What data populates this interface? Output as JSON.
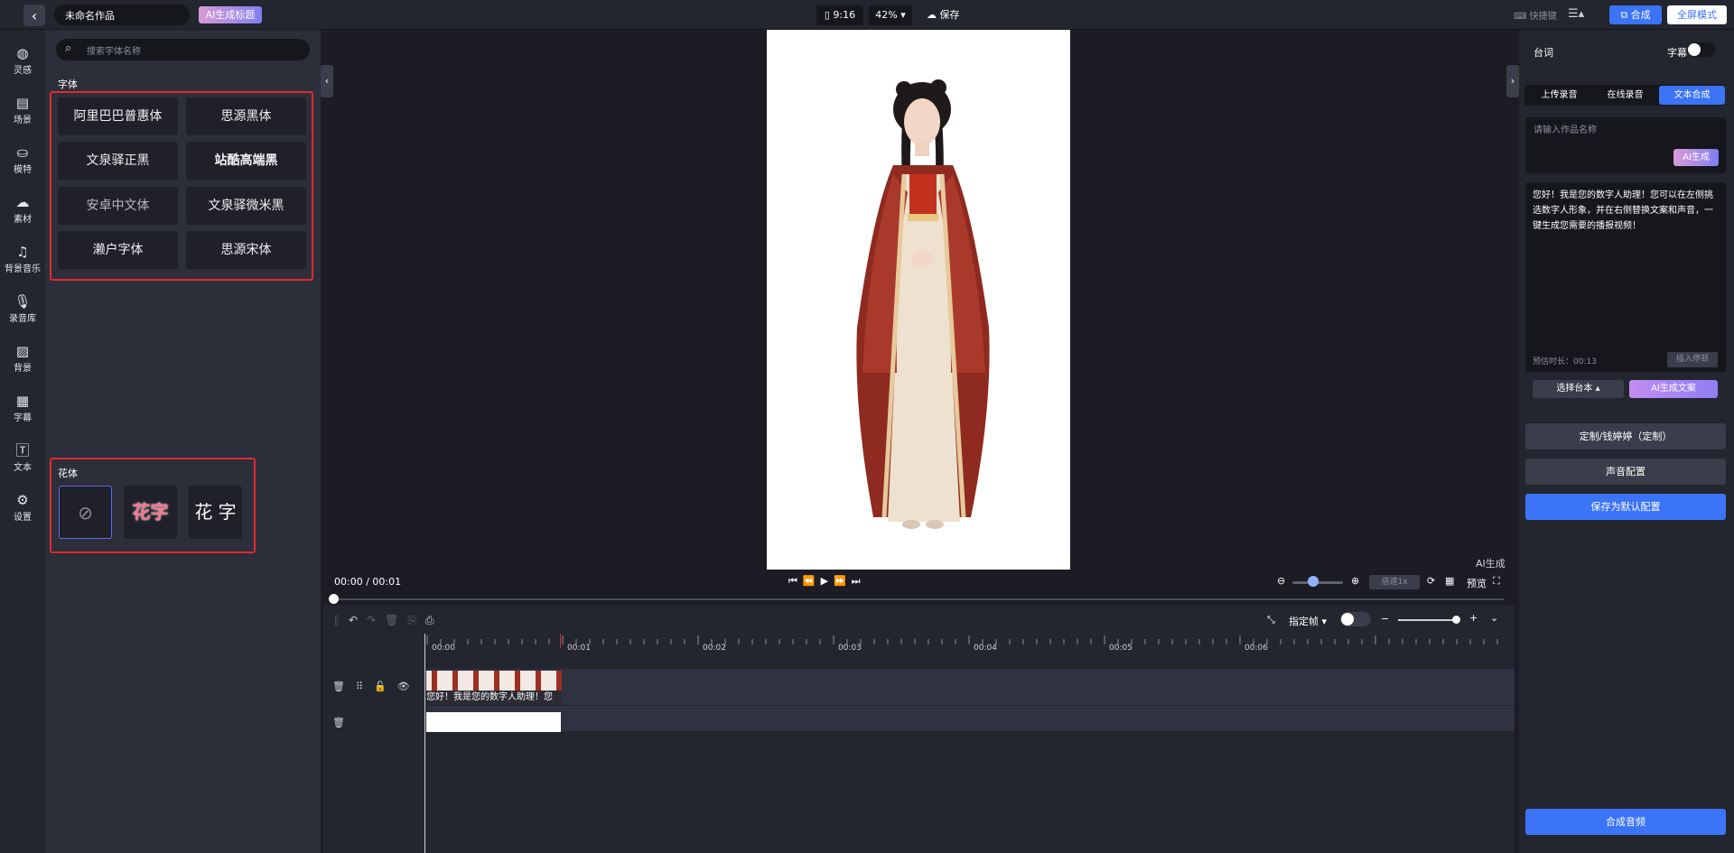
{
  "topbar": {
    "back_icon": "chevron-left-icon",
    "project_name": "未命名作品",
    "ai_title_label": "AI生成标题",
    "ratio": "9:16",
    "zoom": "42%",
    "save_label": "保存",
    "shortcut_label": "快捷键",
    "compose_label": "合成",
    "fullscreen_label": "全屏模式"
  },
  "leftnav": {
    "items": [
      {
        "label": "灵感",
        "icon": "lightbulb-icon"
      },
      {
        "label": "场景",
        "icon": "scene-icon"
      },
      {
        "label": "模特",
        "icon": "model-icon"
      },
      {
        "label": "素材",
        "icon": "cloud-icon"
      },
      {
        "label": "背景音乐",
        "icon": "music-icon"
      },
      {
        "label": "录音库",
        "icon": "mic-icon"
      },
      {
        "label": "背景",
        "icon": "stripes-icon"
      },
      {
        "label": "字幕",
        "icon": "document-icon"
      },
      {
        "label": "文本",
        "icon": "text-icon"
      },
      {
        "label": "设置",
        "icon": "gear-icon"
      }
    ]
  },
  "fontpanel": {
    "search_placeholder": "搜索字体名称",
    "font_section_title": "字体",
    "fonts": [
      "阿里巴巴普惠体",
      "思源黑体",
      "文泉驿正黑",
      "站酷高端黑",
      "安卓中文体",
      "文泉驿微米黑",
      "濑户字体",
      "思源宋体"
    ],
    "fancy_section_title": "花体",
    "fancy_items": [
      {
        "label": "",
        "icon": "none-icon"
      },
      {
        "label": "花字",
        "color": "#f5768f"
      },
      {
        "label": "花 字",
        "color": "#ffffff"
      }
    ]
  },
  "preview": {
    "time_display": "00:00 / 00:01",
    "ai_badge": "AI生成",
    "speed_label": "倍速1x",
    "preview_label": "预览"
  },
  "timeline": {
    "ticks": [
      "00:00",
      "00:01",
      "00:02",
      "00:03",
      "00:04",
      "00:05",
      "00:06"
    ],
    "clip_text": "您好！我是您的数字人助理！您",
    "keyframe_label": "指定帧"
  },
  "rightpanel": {
    "title": "台词",
    "subtitle_toggle_label": "字幕",
    "tabs": [
      "上传录音",
      "在线录音",
      "文本合成"
    ],
    "active_tab": "文本合成",
    "name_placeholder": "请输入作品名称",
    "ai_gen_small": "AI生成",
    "script_text": "您好！我是您的数字人助理！您可以在左侧挑选数字人形象，并在右侧替换文案和声音，一键生成您需要的播报视频！",
    "estimated_duration": "预估时长：00:13",
    "insert_pause": "插入停顿",
    "choose_script": "选择台本",
    "ai_copy": "AI生成文案",
    "custom_voice": "定制/钱婷婷（定制）",
    "voice_config": "声音配置",
    "save_default": "保存为默认配置",
    "compose_audio": "合成音频"
  },
  "colors": {
    "accent_blue": "#3b74f6",
    "highlight_red": "#e0282e",
    "ai_gradient_start": "#d99bd8",
    "ai_gradient_end": "#7f7ef0"
  }
}
